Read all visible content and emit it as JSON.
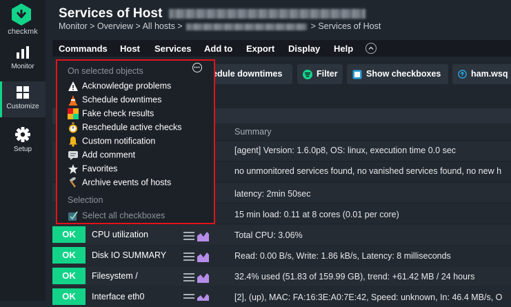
{
  "sidebar": {
    "logo_text": "checkmk",
    "items": [
      {
        "label": "Monitor",
        "icon": "bar-chart-icon"
      },
      {
        "label": "Customize",
        "icon": "grid-icon"
      },
      {
        "label": "Setup",
        "icon": "gear-icon"
      }
    ]
  },
  "header": {
    "title": "Services of Host",
    "breadcrumb_prefix": "Monitor > Overview > All hosts >",
    "breadcrumb_suffix": "> Services of Host"
  },
  "menubar": [
    "Commands",
    "Host",
    "Services",
    "Add to",
    "Export",
    "Display",
    "Help"
  ],
  "toolbar": {
    "schedule_downtimes": "edule downtimes",
    "filter": "Filter",
    "show_checkboxes": "Show checkboxes",
    "host_link": "ham.wsq"
  },
  "dropdown": {
    "section1": "On selected objects",
    "items": [
      {
        "label": "Acknowledge problems",
        "icon": "warning-icon"
      },
      {
        "label": "Schedule downtimes",
        "icon": "cone-icon"
      },
      {
        "label": "Fake check results",
        "icon": "fake-results-icon"
      },
      {
        "label": "Reschedule active checks",
        "icon": "stopwatch-icon"
      },
      {
        "label": "Custom notification",
        "icon": "bell-icon"
      },
      {
        "label": "Add comment",
        "icon": "comment-icon"
      },
      {
        "label": "Favorites",
        "icon": "star-icon"
      },
      {
        "label": "Archive events of hosts",
        "icon": "hammer-icon"
      }
    ],
    "section2": "Selection",
    "select_all": "Select all checkboxes"
  },
  "table": {
    "summary_header": "Summary",
    "partial_rows": [
      "[agent] Version: 1.6.0p8, OS: linux, execution time 0.0 sec",
      "no unmonitored services found, no vanished services found, no new h",
      "latency: 2min 50sec",
      "15 min load: 0.11 at 8 cores (0.01 per core)"
    ],
    "rows": [
      {
        "state": "OK",
        "service": "CPU utilization",
        "summary": "Total CPU: 3.06%"
      },
      {
        "state": "OK",
        "service": "Disk IO SUMMARY",
        "summary": "Read: 0.00 B/s, Write: 1.86 kB/s, Latency: 8 milliseconds"
      },
      {
        "state": "OK",
        "service": "Filesystem /",
        "summary": "32.4% used (51.83 of 159.99 GB), trend: +61.42 MB / 24 hours"
      },
      {
        "state": "OK",
        "service": "Interface eth0",
        "summary": "[2], (up), MAC: FA:16:3E:A0:7E:42, Speed: unknown, In: 46.4 MB/s, O"
      }
    ]
  },
  "colors": {
    "accent": "#13d389",
    "highlight_border": "#e0151b",
    "background": "#20262e"
  }
}
